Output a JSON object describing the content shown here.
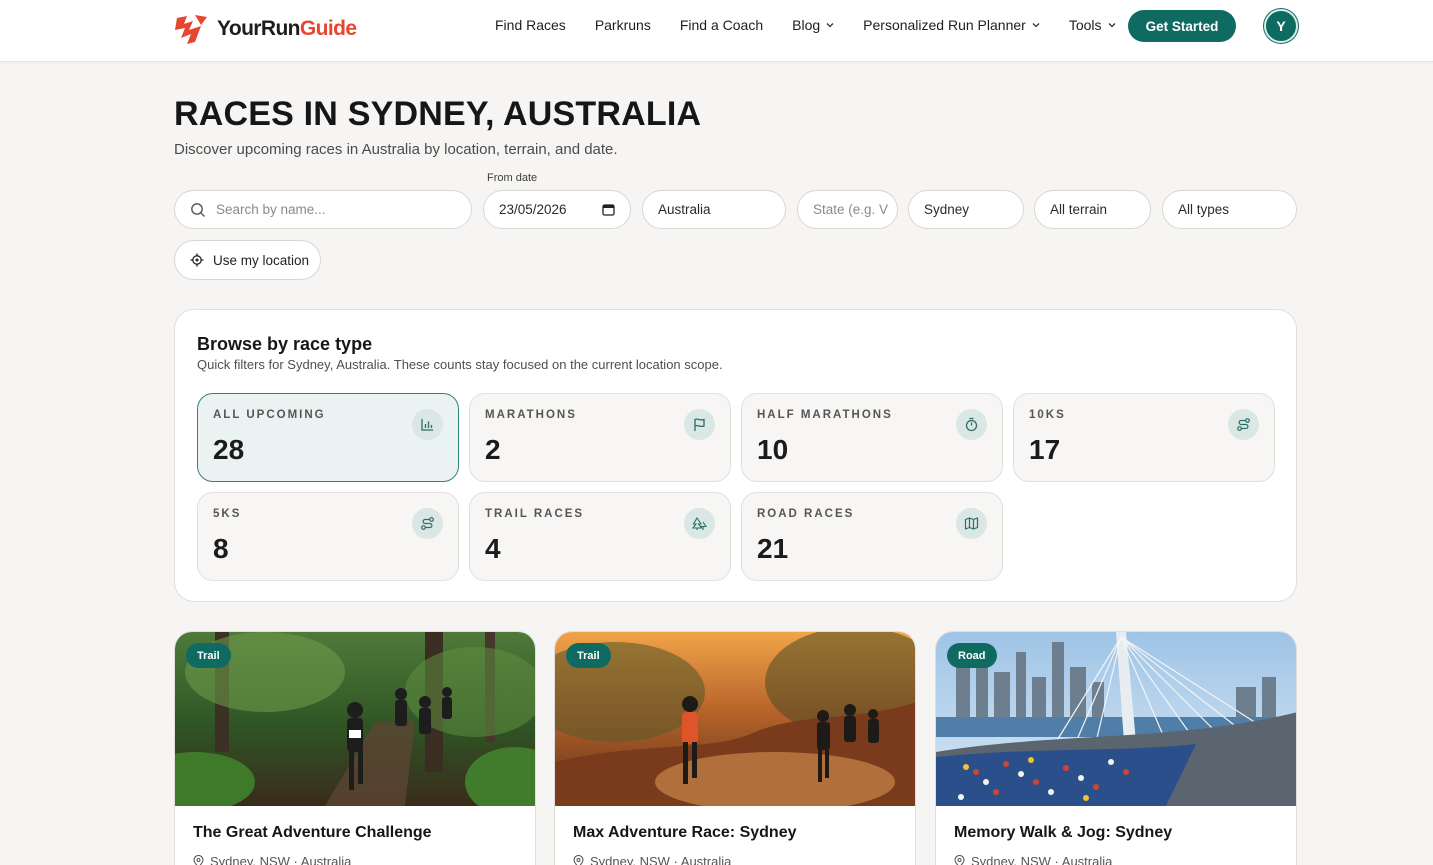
{
  "brand": {
    "name_part1": "YourRun",
    "name_part2": "Guide",
    "accent": "#e8462f",
    "primary": "#0f6b62"
  },
  "nav": {
    "items": [
      {
        "label": "Find Races",
        "dropdown": false
      },
      {
        "label": "Parkruns",
        "dropdown": false
      },
      {
        "label": "Find a Coach",
        "dropdown": false
      },
      {
        "label": "Blog",
        "dropdown": true
      },
      {
        "label": "Personalized Run Planner",
        "dropdown": true
      },
      {
        "label": "Tools",
        "dropdown": true
      }
    ],
    "cta_label": "Get Started",
    "avatar_initial": "Y"
  },
  "page": {
    "title": "RACES IN SYDNEY, AUSTRALIA",
    "subtitle": "Discover upcoming races in Australia by location, terrain, and date."
  },
  "filters": {
    "search_placeholder": "Search by name...",
    "from_date_label": "From date",
    "from_date_value": "23/05/2026",
    "country": "Australia",
    "state_placeholder": "State (e.g. V",
    "city": "Sydney",
    "terrain": "All terrain",
    "type": "All types",
    "location_button": "Use my location"
  },
  "browse": {
    "title": "Browse by race type",
    "subtitle": "Quick filters for Sydney, Australia. These counts stay focused on the current location scope.",
    "tiles": [
      {
        "label": "ALL UPCOMING",
        "count": "28",
        "icon": "bar-chart-icon",
        "active": true
      },
      {
        "label": "MARATHONS",
        "count": "2",
        "icon": "flag-icon",
        "active": false
      },
      {
        "label": "HALF MARATHONS",
        "count": "10",
        "icon": "stopwatch-icon",
        "active": false
      },
      {
        "label": "10KS",
        "count": "17",
        "icon": "route-icon",
        "active": false
      },
      {
        "label": "5KS",
        "count": "8",
        "icon": "route-icon",
        "active": false
      },
      {
        "label": "TRAIL RACES",
        "count": "4",
        "icon": "trees-icon",
        "active": false
      },
      {
        "label": "ROAD RACES",
        "count": "21",
        "icon": "map-icon",
        "active": false
      }
    ]
  },
  "races": [
    {
      "badge": "Trail",
      "title": "The Great Adventure Challenge",
      "location": "Sydney, NSW · Australia",
      "image": "forest-trail-runners-photo"
    },
    {
      "badge": "Trail",
      "title": "Max Adventure Race: Sydney",
      "location": "Sydney, NSW · Australia",
      "image": "sunset-bush-trail-runners-photo"
    },
    {
      "badge": "Road",
      "title": "Memory Walk & Jog: Sydney",
      "location": "Sydney, NSW · Australia",
      "image": "harbour-bridge-marathon-photo"
    }
  ]
}
